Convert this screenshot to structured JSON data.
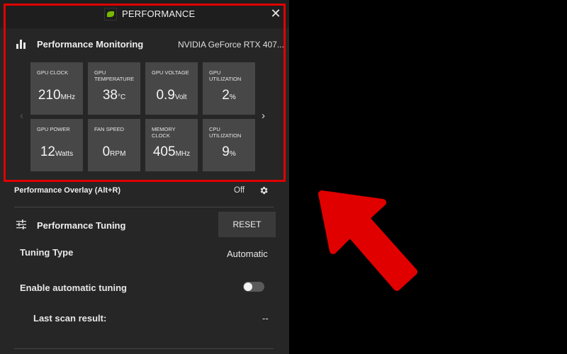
{
  "window": {
    "title": "PERFORMANCE",
    "close_glyph": "✕",
    "logo_icon": "nvidia-logo-icon"
  },
  "monitoring": {
    "title": "Performance Monitoring",
    "gpu_name": "NVIDIA GeForce RTX 407...",
    "prev_glyph": "‹",
    "next_glyph": "›",
    "tiles": [
      {
        "label": "GPU CLOCK",
        "value": "210",
        "unit": "MHz"
      },
      {
        "label": "GPU TEMPERATURE",
        "value": "38",
        "unit": "°C"
      },
      {
        "label": "GPU VOLTAGE",
        "value": "0.9",
        "unit": "Volt"
      },
      {
        "label": "GPU UTILIZATION",
        "value": "2",
        "unit": "%"
      },
      {
        "label": "GPU POWER",
        "value": "12",
        "unit": "Watts"
      },
      {
        "label": "FAN SPEED",
        "value": "0",
        "unit": "RPM"
      },
      {
        "label": "MEMORY CLOCK",
        "value": "405",
        "unit": "MHz"
      },
      {
        "label": "CPU UTILIZATION",
        "value": "9",
        "unit": "%"
      }
    ]
  },
  "overlay": {
    "label": "Performance Overlay (Alt+R)",
    "state": "Off"
  },
  "tuning": {
    "title": "Performance Tuning",
    "reset_label": "RESET",
    "type_label": "Tuning Type",
    "type_value": "Automatic",
    "auto_label": "Enable automatic tuning",
    "auto_enabled": false,
    "scan_label": "Last scan result:",
    "scan_value": "--"
  },
  "colors": {
    "highlight": "#e10000",
    "nvidia_green": "#76b900",
    "panel": "#262626"
  }
}
